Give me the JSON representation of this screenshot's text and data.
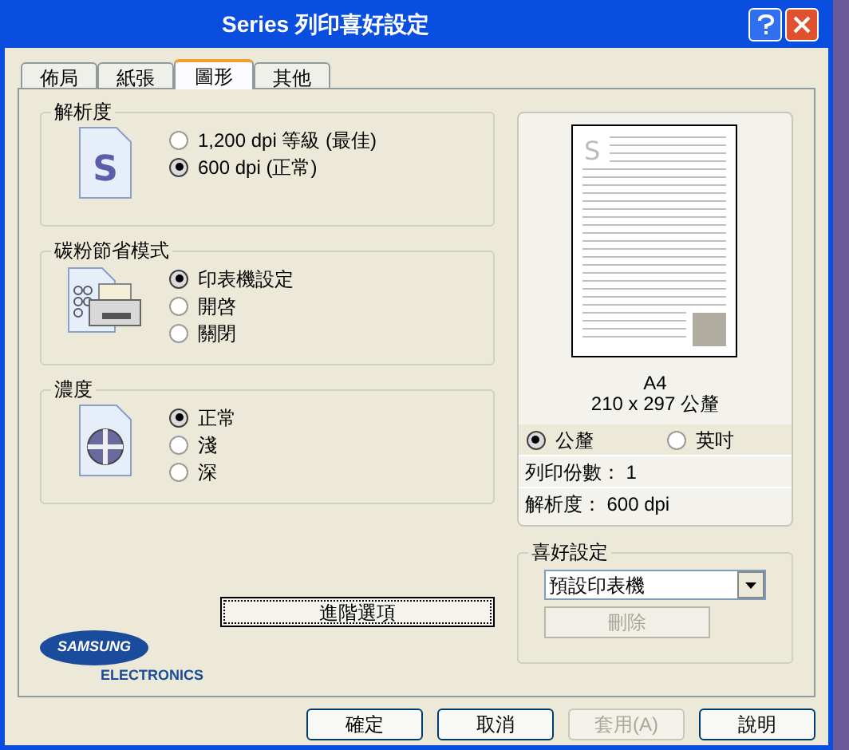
{
  "window": {
    "title": "Series 列印喜好設定"
  },
  "tabs": [
    {
      "label": "佈局",
      "selected": false
    },
    {
      "label": "紙張",
      "selected": false
    },
    {
      "label": "圖形",
      "selected": true
    },
    {
      "label": "其他",
      "selected": false
    }
  ],
  "groups": [
    {
      "title": "解析度",
      "kind": "document",
      "icon_letter": "S",
      "options": [
        {
          "label": "1,200 dpi 等級 (最佳)",
          "selected": false
        },
        {
          "label": "600 dpi (正常)",
          "selected": true
        }
      ]
    },
    {
      "title": "碳粉節省模式",
      "kind": "printer",
      "options": [
        {
          "label": "印表機設定",
          "selected": true
        },
        {
          "label": "開啓",
          "selected": false
        },
        {
          "label": "關閉",
          "selected": false
        }
      ]
    },
    {
      "title": "濃度",
      "kind": "density",
      "options": [
        {
          "label": "正常",
          "selected": true
        },
        {
          "label": "淺",
          "selected": false
        },
        {
          "label": "深",
          "selected": false
        }
      ]
    }
  ],
  "advanced_button": "進階選項",
  "logo": {
    "brand": "SAMSUNG",
    "sub": "ELECTRONICS"
  },
  "preview": {
    "page_letter": "S",
    "paper": "A4",
    "size": "210 x 297 公釐",
    "units": [
      {
        "label": "公釐",
        "selected": true
      },
      {
        "label": "英吋",
        "selected": false
      }
    ],
    "copies": "列印份數： 1",
    "resolution": "解析度： 600 dpi"
  },
  "favorites": {
    "title": "喜好設定",
    "value": "預設印表機",
    "delete_button": {
      "label": "刪除",
      "disabled": true
    }
  },
  "buttons": [
    {
      "label": "確定",
      "disabled": false
    },
    {
      "label": "取消",
      "disabled": false
    },
    {
      "label": "套用(A)",
      "disabled": true
    },
    {
      "label": "說明",
      "disabled": false
    }
  ]
}
